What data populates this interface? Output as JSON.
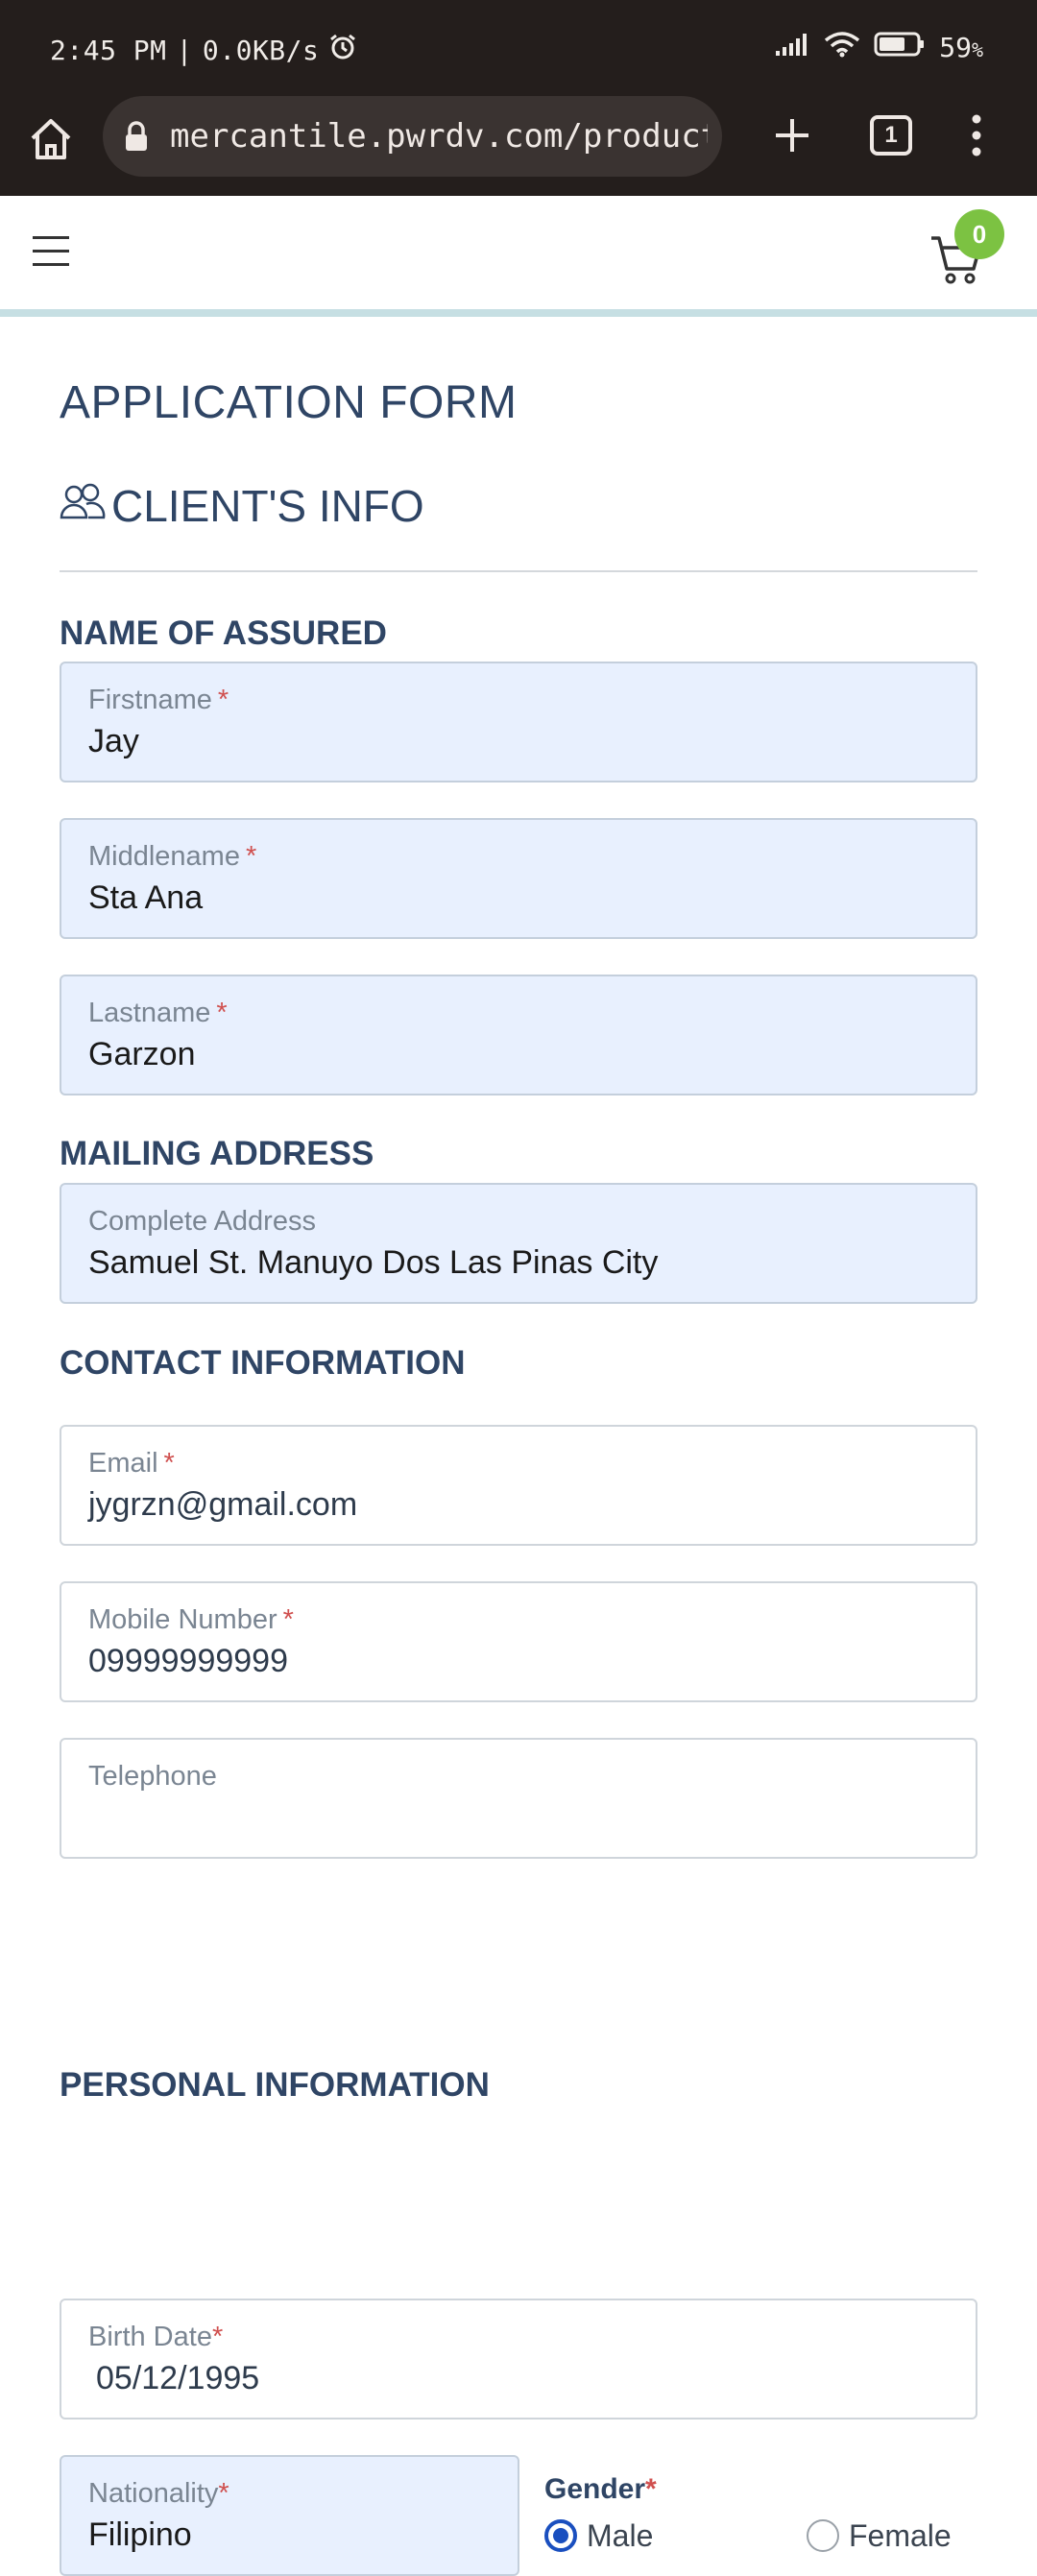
{
  "status_bar": {
    "time": "2:45 PM",
    "separator": "|",
    "speed": "0.0KB/s",
    "alarm_icon": "alarm-icon",
    "signal_icon": "signal-icon",
    "wifi_icon": "wifi-icon",
    "battery_icon": "battery-icon",
    "battery": "59",
    "battery_unit": "%"
  },
  "browser": {
    "url": "mercantile.pwrdv.com/product/D",
    "tab_count": "1"
  },
  "header": {
    "cart_count": "0"
  },
  "form": {
    "title": "APPLICATION FORM",
    "section_title": "CLIENT'S INFO",
    "name_heading": "NAME OF ASSURED",
    "firstname": {
      "label": "Firstname",
      "required": "*",
      "value": "Jay"
    },
    "middlename": {
      "label": "Middlename",
      "required": "*",
      "value": "Sta Ana"
    },
    "lastname": {
      "label": "Lastname",
      "required": "*",
      "value": "Garzon"
    },
    "mailing_heading": "MAILING ADDRESS",
    "address": {
      "label": "Complete Address",
      "value": "Samuel St. Manuyo Dos Las Pinas City"
    },
    "contact_heading": "CONTACT INFORMATION",
    "email": {
      "label": "Email",
      "required": "*",
      "value": "jygrzn@gmail.com"
    },
    "mobile": {
      "label": "Mobile Number",
      "required": "*",
      "value": "09999999999"
    },
    "telephone": {
      "label": "Telephone",
      "value": ""
    },
    "personal_heading": "PERSONAL INFORMATION",
    "birth_date": {
      "label": "Birth Date",
      "required": "*",
      "value": "05/12/1995"
    },
    "nationality": {
      "label": "Nationality",
      "required": "*",
      "value": "Filipino"
    },
    "gender": {
      "label": "Gender",
      "required": "*",
      "options": [
        "Male",
        "Female"
      ],
      "selected": "Male"
    }
  }
}
